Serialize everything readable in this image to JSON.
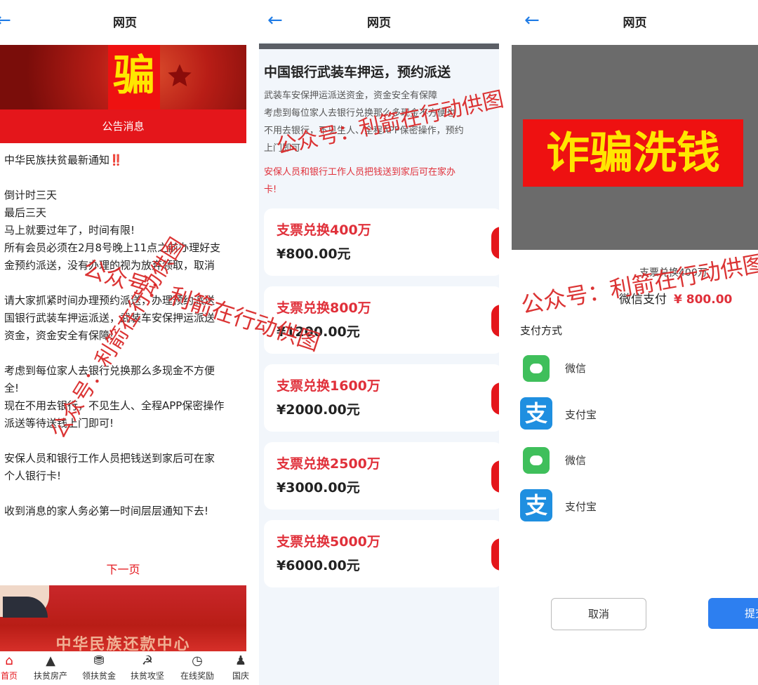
{
  "colors": {
    "accent_red": "#e4161b",
    "price_red": "#e0303a",
    "blue": "#1e7be6",
    "scam_yellow": "#ffe600"
  },
  "panel1": {
    "back_icon": "arrow-left-icon",
    "title": "网页",
    "stamp": "骗",
    "notice_label": "公告消息",
    "lines": [
      "中华民族扶贫最新通知",
      "",
      "倒计时三天",
      "最后三天",
      "马上就要过年了，时间有限!",
      "所有会员必须在2月8号晚上11点之前办理好支",
      "金预约派送，没有办理的视为放弃领取，取消",
      "",
      "请大家抓紧时间办理预约派送，办理预约派送",
      "国银行武装车押运派送，武装车安保押运派送",
      "资金，资金安全有保障!",
      "",
      "考虑到每位家人去银行兑换那么多现金不方便",
      "全!",
      "现在不用去银行，不见生人、全程APP保密操作",
      "派送等待送钱上门即可!",
      "",
      "安保人员和银行工作人员把钱送到家后可在家",
      "个人银行卡!",
      "",
      "收到消息的家人务必第一时间层层通知下去!"
    ],
    "exclaim": "‼️",
    "next_page": "下一页",
    "banner_text": "中华民族还款中心",
    "tabs": [
      {
        "label": "首页",
        "icon": "home-icon"
      },
      {
        "label": "扶贫房产",
        "icon": "house-icon"
      },
      {
        "label": "领扶贫金",
        "icon": "coins-icon"
      },
      {
        "label": "扶贫攻坚",
        "icon": "emblem-icon"
      },
      {
        "label": "在线奖励",
        "icon": "clock-icon"
      },
      {
        "label": "国庆",
        "icon": "user-icon"
      }
    ]
  },
  "panel2": {
    "back_icon": "arrow-left-icon",
    "title": "网页",
    "heading": "中国银行武装车押运，预约派送",
    "desc_lines": [
      "武装车安保押运派送资金，资金安全有保障",
      "考虑到每位家人去银行兑换那么多现金不方便也",
      "不用去银行，不见生人、全程APP保密操作，预约",
      "上门即可"
    ],
    "red_lines": [
      "安保人员和银行工作人员把钱送到家后可在家办",
      "卡!"
    ],
    "cards": [
      {
        "title": "支票兑换400万",
        "price": "¥800.00元"
      },
      {
        "title": "支票兑换800万",
        "price": "¥1200.00元"
      },
      {
        "title": "支票兑换1600万",
        "price": "¥2000.00元"
      },
      {
        "title": "支票兑换2500万",
        "price": "¥3000.00元"
      },
      {
        "title": "支票兑换5000万",
        "price": "¥6000.00元"
      }
    ]
  },
  "panel3": {
    "back_icon": "arrow-left-icon",
    "title": "网页",
    "scam_label": "诈骗洗钱",
    "item": "支票兑换400万",
    "pay_label": "微信支付",
    "amount": "¥ 800.00",
    "method_label": "支付方式",
    "methods": [
      {
        "name": "微信",
        "icon": "wechat-icon"
      },
      {
        "name": "支付宝",
        "icon": "alipay-icon"
      },
      {
        "name": "微信",
        "icon": "wechat-icon"
      },
      {
        "name": "支付宝",
        "icon": "alipay-icon"
      }
    ],
    "alipay_glyph": "支",
    "cancel": "取消",
    "submit": "提交"
  },
  "watermark": {
    "text": "公众号：利箭在行动供图"
  }
}
